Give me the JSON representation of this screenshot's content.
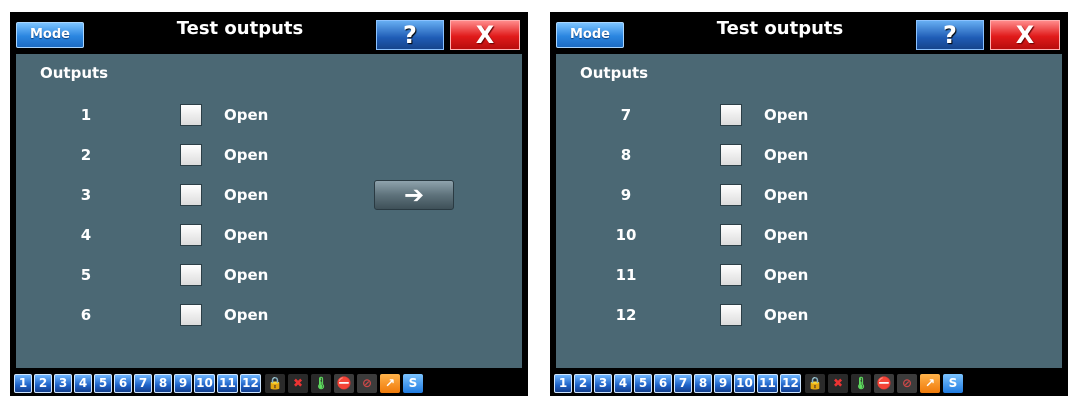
{
  "screens": [
    {
      "title": "Test outputs",
      "mode_label": "Mode",
      "help_label": "?",
      "close_label": "X",
      "section_label": "Outputs",
      "outputs": [
        {
          "number": "1",
          "state": "Open"
        },
        {
          "number": "2",
          "state": "Open"
        },
        {
          "number": "3",
          "state": "Open"
        },
        {
          "number": "4",
          "state": "Open"
        },
        {
          "number": "5",
          "state": "Open"
        },
        {
          "number": "6",
          "state": "Open"
        }
      ],
      "next_label": "➔"
    },
    {
      "title": "Test outputs",
      "mode_label": "Mode",
      "help_label": "?",
      "close_label": "X",
      "section_label": "Outputs",
      "outputs": [
        {
          "number": "7",
          "state": "Open"
        },
        {
          "number": "8",
          "state": "Open"
        },
        {
          "number": "9",
          "state": "Open"
        },
        {
          "number": "10",
          "state": "Open"
        },
        {
          "number": "11",
          "state": "Open"
        },
        {
          "number": "12",
          "state": "Open"
        }
      ]
    }
  ],
  "bottom_bar": {
    "numbers": [
      "1",
      "2",
      "3",
      "4",
      "5",
      "6",
      "7",
      "8",
      "9",
      "10",
      "11",
      "12"
    ],
    "icons": [
      {
        "name": "lock-icon",
        "glyph": "🔒"
      },
      {
        "name": "no-arrows-icon",
        "glyph": "✖"
      },
      {
        "name": "thermometer-icon",
        "glyph": "🌡"
      },
      {
        "name": "no-link-icon",
        "glyph": "⛔"
      },
      {
        "name": "no-chart-icon",
        "glyph": "⊘"
      },
      {
        "name": "arrow-up-right-icon",
        "glyph": "↗"
      },
      {
        "name": "s-icon",
        "glyph": "S"
      }
    ]
  },
  "colors": {
    "panel_bg": "#4b6874",
    "bar_bg": "#000000",
    "blue_button": "#1f63c8",
    "close_red": "#e01a1a"
  }
}
